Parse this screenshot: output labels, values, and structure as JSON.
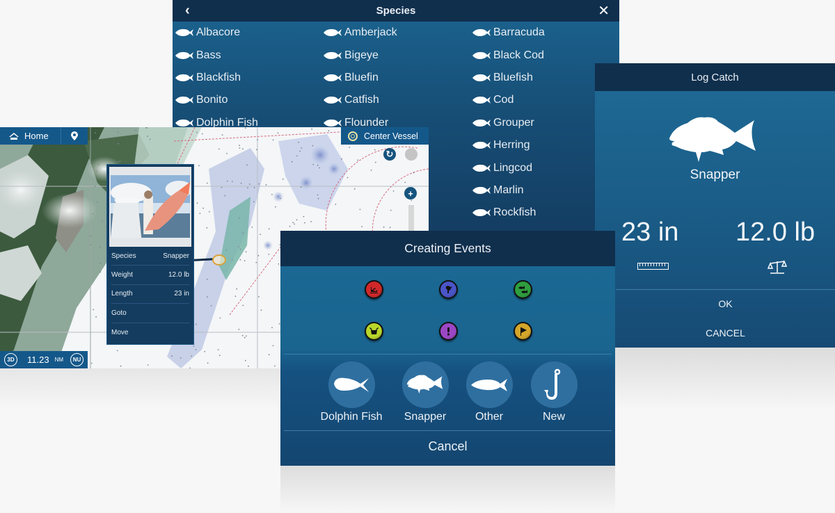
{
  "species_panel": {
    "title": "Species",
    "back_icon": "chevron-left-icon",
    "close_icon": "close-icon",
    "columns": [
      [
        "Albacore",
        "Bass",
        "Blackfish",
        "Bonito",
        "Dolphin Fish"
      ],
      [
        "Amberjack",
        "Bigeye",
        "Bluefin",
        "Catfish",
        "Flounder"
      ],
      [
        "Barracuda",
        "Black Cod",
        "Bluefish",
        "Cod",
        "Grouper",
        "Herring",
        "Lingcod",
        "Marlin",
        "Rockfish"
      ]
    ]
  },
  "map_panel": {
    "home_label": "Home",
    "home_icon": "home-icon",
    "waypoint_icon": "map-pin-icon",
    "center_vessel_label": "Center Vessel",
    "range_value": "11.23",
    "range_unit": "NM",
    "view_mode": "3D",
    "orientation": "NU",
    "popup": {
      "rows": [
        {
          "label": "Species",
          "value": "Snapper"
        },
        {
          "label": "Weight",
          "value": "12.0 lb"
        },
        {
          "label": "Length",
          "value": "23 in"
        },
        {
          "label": "Goto",
          "value": ""
        },
        {
          "label": "Move",
          "value": ""
        }
      ]
    }
  },
  "log_catch": {
    "title": "Log Catch",
    "species": "Snapper",
    "length": "23 in",
    "weight": "12.0 lb",
    "ok_label": "OK",
    "cancel_label": "CANCEL"
  },
  "creating_events": {
    "title": "Creating Events",
    "event_icons": [
      {
        "name": "wreck-event-icon",
        "color": "#d0282a"
      },
      {
        "name": "diver-event-icon",
        "color": "#4a55c8"
      },
      {
        "name": "fish-school-event-icon",
        "color": "#2f9e3e"
      },
      {
        "name": "crab-trap-event-icon",
        "color": "#b8d62a"
      },
      {
        "name": "warning-event-icon",
        "color": "#9b47c4"
      },
      {
        "name": "flag-event-icon",
        "color": "#d3a52a"
      }
    ],
    "quick_buttons": [
      "Dolphin Fish",
      "Snapper",
      "Other",
      "New"
    ],
    "cancel_label": "Cancel"
  }
}
